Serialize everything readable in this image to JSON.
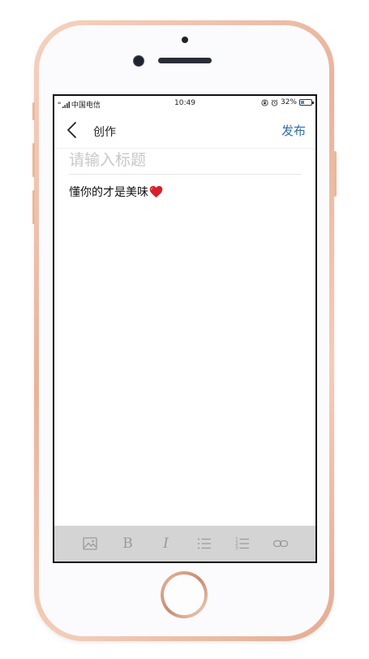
{
  "status_bar": {
    "signal": "⁴⁶",
    "carrier": "中国电信",
    "time": "10:49",
    "battery": "32%",
    "battery_level": 0.32,
    "battery_color": "#3a8ee6"
  },
  "navbar": {
    "title": "创作",
    "publish_label": "发布",
    "publish_color": "#2f6ea8"
  },
  "editor": {
    "title_placeholder": "请输入标题",
    "body_text": "懂你的才是美味",
    "emoji": "heart-emoji"
  },
  "toolbar": {
    "background": "#d4d4d4",
    "items": [
      {
        "icon": "image-icon"
      },
      {
        "icon": "bold-icon",
        "label": "B"
      },
      {
        "icon": "italic-icon",
        "label": "I"
      },
      {
        "icon": "bulleted-list-icon"
      },
      {
        "icon": "numbered-list-icon"
      },
      {
        "icon": "link-icon"
      }
    ]
  }
}
